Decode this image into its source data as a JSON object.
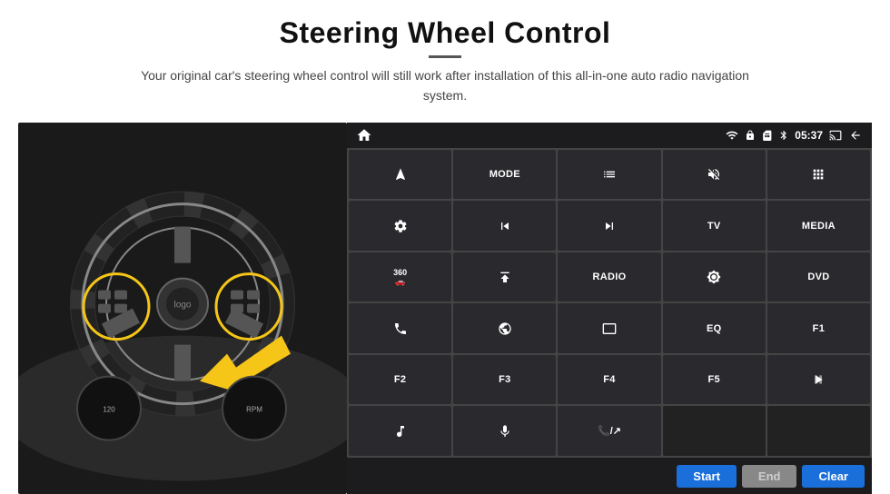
{
  "header": {
    "title": "Steering Wheel Control",
    "subtitle": "Your original car's steering wheel control will still work after installation of this all-in-one auto radio navigation system."
  },
  "statusBar": {
    "time": "05:37",
    "icons": [
      "wifi",
      "lock",
      "sim",
      "bluetooth",
      "cast",
      "back"
    ]
  },
  "buttons": [
    {
      "id": "r1c1",
      "type": "icon",
      "icon": "navigate",
      "text": ""
    },
    {
      "id": "r1c2",
      "type": "text",
      "text": "MODE"
    },
    {
      "id": "r1c3",
      "type": "icon",
      "icon": "list"
    },
    {
      "id": "r1c4",
      "type": "icon",
      "icon": "mute"
    },
    {
      "id": "r1c5",
      "type": "icon",
      "icon": "apps"
    },
    {
      "id": "r2c1",
      "type": "icon",
      "icon": "settings"
    },
    {
      "id": "r2c2",
      "type": "icon",
      "icon": "prev"
    },
    {
      "id": "r2c3",
      "type": "icon",
      "icon": "next"
    },
    {
      "id": "r2c4",
      "type": "text",
      "text": "TV"
    },
    {
      "id": "r2c5",
      "type": "text",
      "text": "MEDIA"
    },
    {
      "id": "r3c1",
      "type": "icon",
      "icon": "360cam"
    },
    {
      "id": "r3c2",
      "type": "icon",
      "icon": "eject"
    },
    {
      "id": "r3c3",
      "type": "text",
      "text": "RADIO"
    },
    {
      "id": "r3c4",
      "type": "icon",
      "icon": "brightness"
    },
    {
      "id": "r3c5",
      "type": "text",
      "text": "DVD"
    },
    {
      "id": "r4c1",
      "type": "icon",
      "icon": "phone"
    },
    {
      "id": "r4c2",
      "type": "icon",
      "icon": "browser"
    },
    {
      "id": "r4c3",
      "type": "icon",
      "icon": "screen"
    },
    {
      "id": "r4c4",
      "type": "text",
      "text": "EQ"
    },
    {
      "id": "r4c5",
      "type": "text",
      "text": "F1"
    },
    {
      "id": "r5c1",
      "type": "text",
      "text": "F2"
    },
    {
      "id": "r5c2",
      "type": "text",
      "text": "F3"
    },
    {
      "id": "r5c3",
      "type": "text",
      "text": "F4"
    },
    {
      "id": "r5c4",
      "type": "text",
      "text": "F5"
    },
    {
      "id": "r5c5",
      "type": "icon",
      "icon": "playpause"
    },
    {
      "id": "r6c1",
      "type": "icon",
      "icon": "music"
    },
    {
      "id": "r6c2",
      "type": "icon",
      "icon": "mic"
    },
    {
      "id": "r6c3",
      "type": "icon",
      "icon": "phonecall"
    },
    {
      "id": "r6c4",
      "type": "empty"
    },
    {
      "id": "r6c5",
      "type": "empty"
    }
  ],
  "bottomBar": {
    "startLabel": "Start",
    "endLabel": "End",
    "clearLabel": "Clear"
  }
}
